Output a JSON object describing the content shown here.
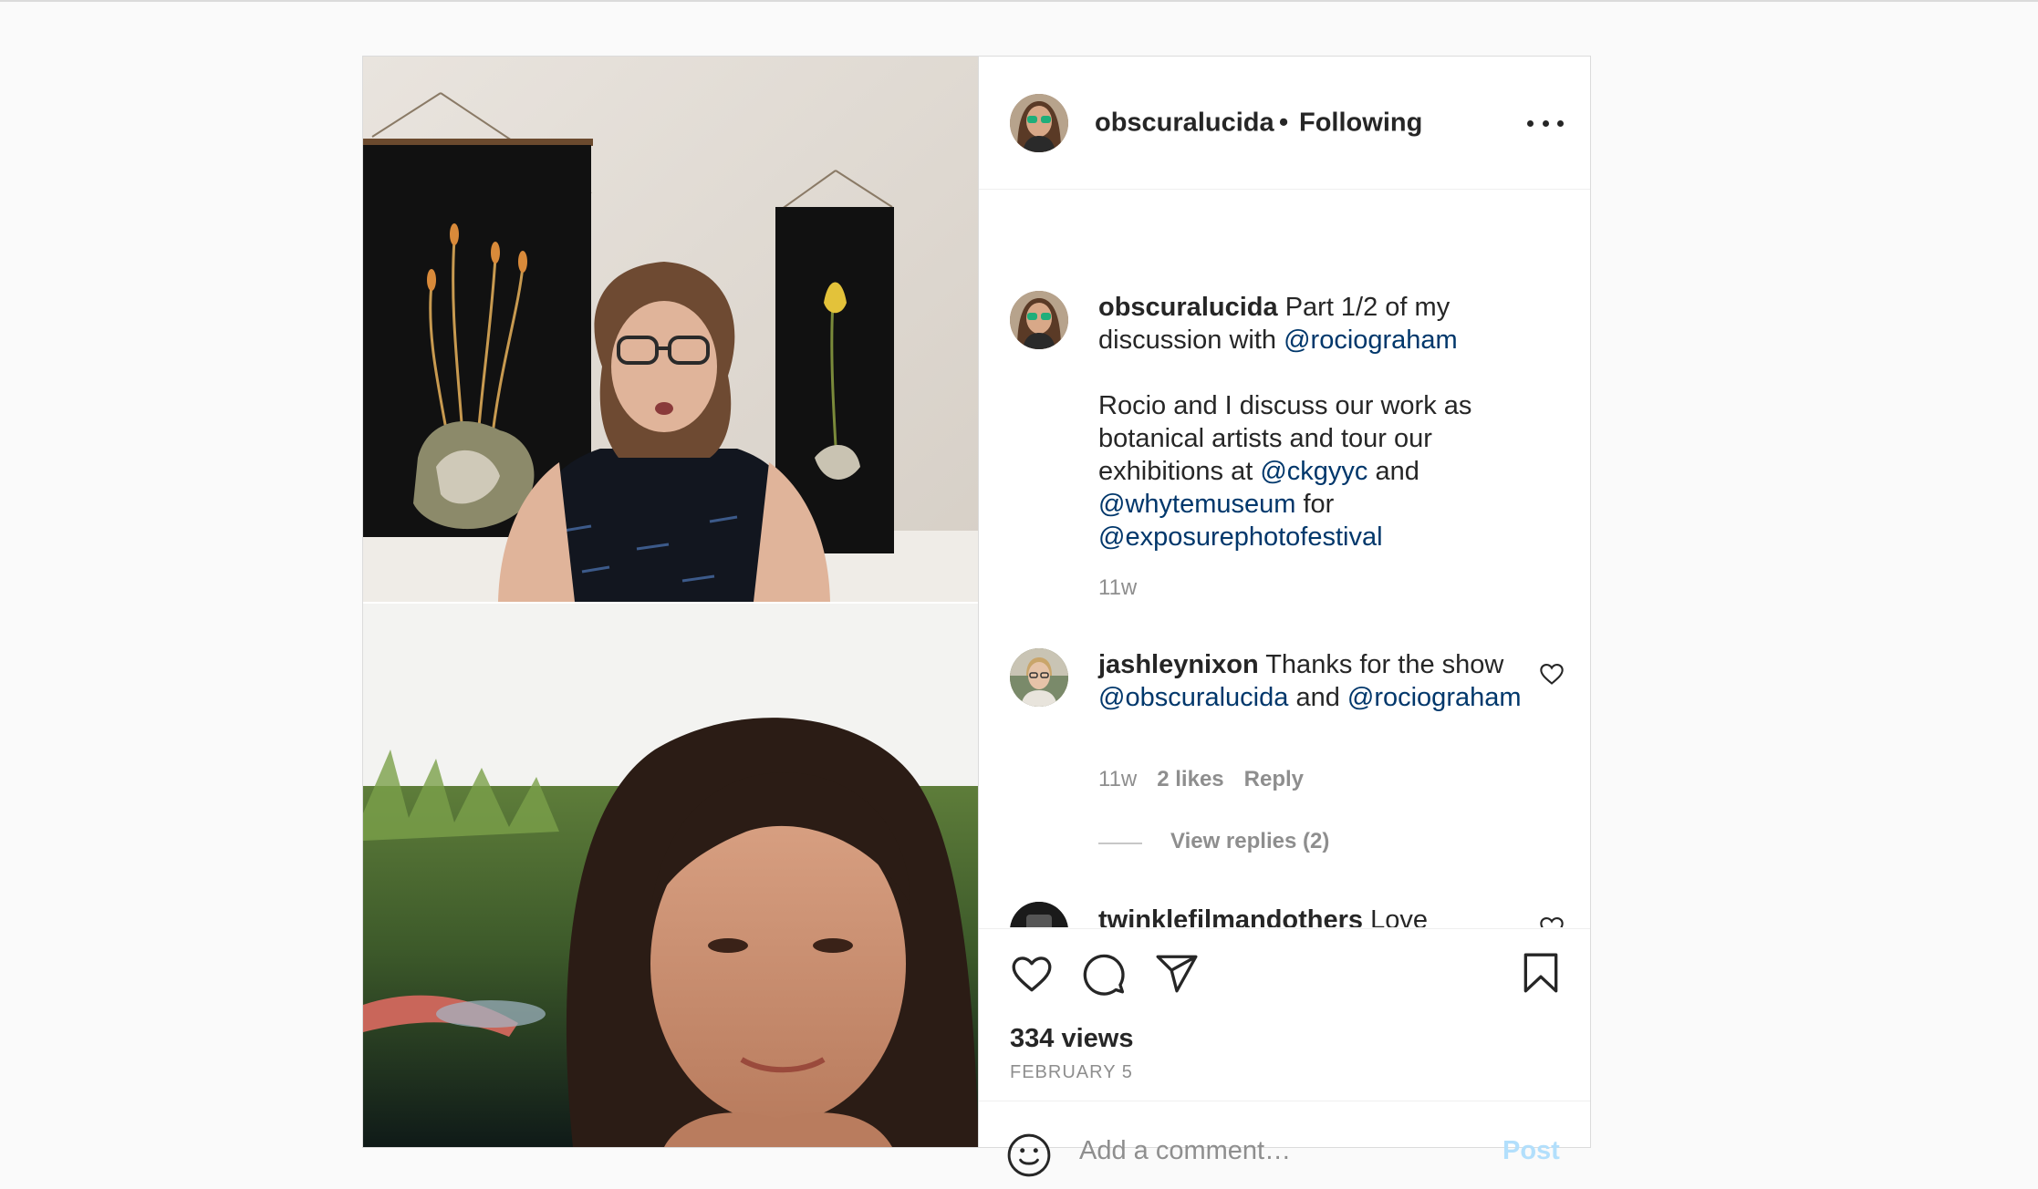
{
  "header": {
    "username": "obscuralucida",
    "separator": "•",
    "follow_status": "Following"
  },
  "caption": {
    "username": "obscuralucida",
    "text_1": "Part 1/2 of my discussion with ",
    "mention_1": "@rociograham",
    "text_2": "Rocio and I discuss our work as botanical artists and tour our exhibitions at ",
    "mention_2": "@ckgyyc",
    "text_3": " and ",
    "mention_3": "@whytemuseum",
    "text_4": " for ",
    "mention_4": "@exposurephotofestival",
    "time": "11w"
  },
  "comments": [
    {
      "username": "jashleynixon",
      "text_1": "Thanks for the show ",
      "mention_1": "@obscuralucida",
      "text_2": " and ",
      "mention_2": "@rociograham",
      "time": "11w",
      "likes": "2 likes",
      "reply_label": "Reply",
      "view_replies": "View replies (2)"
    },
    {
      "username": "twinklefilmandothers",
      "text_1": "Love"
    }
  ],
  "actions": {
    "icons": [
      "heart-icon",
      "comment-icon",
      "share-icon",
      "bookmark-icon"
    ],
    "views": "334 views",
    "date": "FEBRUARY 5"
  },
  "comment_box": {
    "placeholder": "Add a comment…",
    "post_label": "Post"
  },
  "colors": {
    "mention": "#00376b",
    "secondary_text": "#8e8e8e",
    "post_disabled": "#b2dffc",
    "border": "#dbdbdb"
  }
}
